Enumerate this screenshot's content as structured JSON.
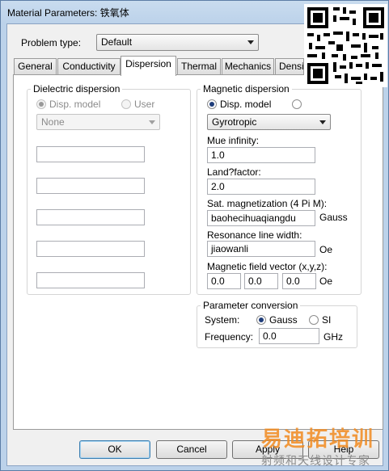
{
  "window": {
    "title": "Material Parameters: 铁氧体"
  },
  "problem_type": {
    "label": "Problem type:",
    "value": "Default"
  },
  "tabs": [
    {
      "label": "General",
      "active": false
    },
    {
      "label": "Conductivity",
      "active": false
    },
    {
      "label": "Dispersion",
      "active": true
    },
    {
      "label": "Thermal",
      "active": false
    },
    {
      "label": "Mechanics",
      "active": false
    },
    {
      "label": "Densit",
      "active": false
    }
  ],
  "dielectric": {
    "title": "Dielectric dispersion",
    "disp_model_label": "Disp. model",
    "user_label": "User",
    "model_value": "None",
    "fields": [
      "",
      "",
      "",
      "",
      ""
    ]
  },
  "magnetic": {
    "title": "Magnetic dispersion",
    "disp_model_label": "Disp. model",
    "model_value": "Gyrotropic",
    "mue_label": "Mue infinity:",
    "mue_value": "1.0",
    "lande_label": "Land?factor:",
    "lande_value": "2.0",
    "sat_label": "Sat. magnetization (4 Pi M):",
    "sat_value": "baohecihuaqiangdu",
    "sat_unit": "Gauss",
    "res_label": "Resonance line width:",
    "res_value": "jiaowanli",
    "res_unit": "Oe",
    "field_label": "Magnetic field vector (x,y,z):",
    "field_x": "0.0",
    "field_y": "0.0",
    "field_z": "0.0",
    "field_unit": "Oe"
  },
  "conversion": {
    "title": "Parameter conversion",
    "system_label": "System:",
    "gauss_label": "Gauss",
    "si_label": "SI",
    "frequency_label": "Frequency:",
    "frequency_value": "0.0",
    "frequency_unit": "GHz"
  },
  "buttons": {
    "ok": "OK",
    "cancel": "Cancel",
    "apply": "Apply",
    "help": "Help"
  },
  "watermark": {
    "line1": "易迪拓培训",
    "line2": "射频和天线设计专家"
  },
  "colors": {
    "titlebar": "#c9dcef",
    "dialog": "#f0f0f0",
    "selected_radio": "#1f3d7a",
    "watermark": "#f28b20"
  }
}
